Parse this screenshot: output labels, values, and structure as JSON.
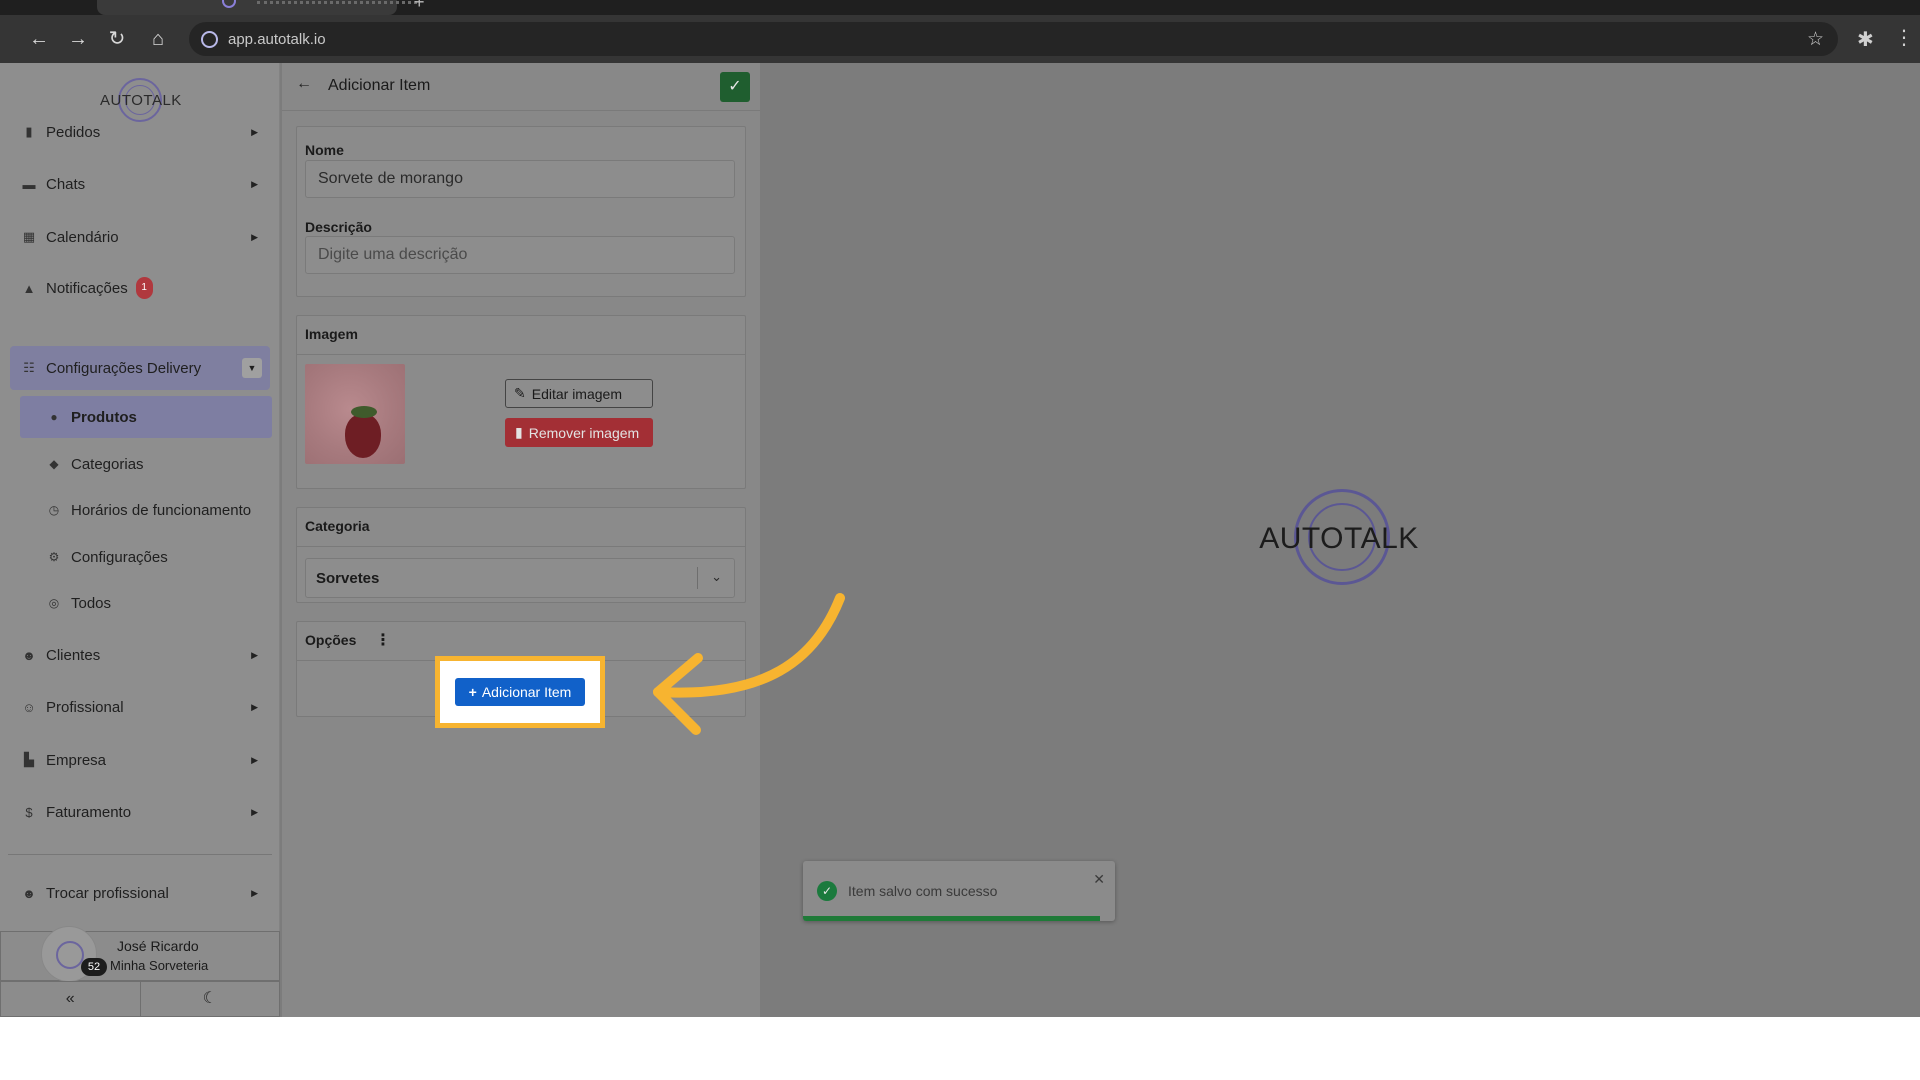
{
  "browser": {
    "url": "app.autotalk.io"
  },
  "sidebar": {
    "logo": "AUTOTALK",
    "items": [
      {
        "label": "Pedidos"
      },
      {
        "label": "Chats"
      },
      {
        "label": "Calendário"
      },
      {
        "label": "Notificações",
        "badge": "1"
      },
      {
        "label": "Configurações Delivery"
      },
      {
        "label": "Clientes"
      },
      {
        "label": "Profissional"
      },
      {
        "label": "Empresa"
      },
      {
        "label": "Faturamento"
      },
      {
        "label": "Trocar profissional"
      }
    ],
    "subitems": [
      {
        "label": "Produtos"
      },
      {
        "label": "Categorias"
      },
      {
        "label": "Horários de funcionamento"
      },
      {
        "label": "Configurações"
      },
      {
        "label": "Todos"
      }
    ],
    "user": {
      "name": "José Ricardo",
      "company": "Minha Sorveteria",
      "count": "52"
    }
  },
  "form": {
    "title": "Adicionar Item",
    "name_label": "Nome",
    "name_value": "Sorvete de morango",
    "description_label": "Descrição",
    "description_placeholder": "Digite uma descrição",
    "image_label": "Imagem",
    "edit_image_label": "Editar imagem",
    "remove_image_label": "Remover imagem",
    "category_label": "Categoria",
    "category_value": "Sorvetes",
    "options_label": "Opções",
    "add_item_label": "Adicionar Item"
  },
  "main": {
    "logo": "AUTOTALK"
  },
  "toast": {
    "message": "Item salvo com sucesso"
  },
  "colors": {
    "accent_highlight": "#f7b430",
    "primary_button": "#1161c9",
    "danger_button": "#a32f35",
    "success": "#1f7a38"
  }
}
